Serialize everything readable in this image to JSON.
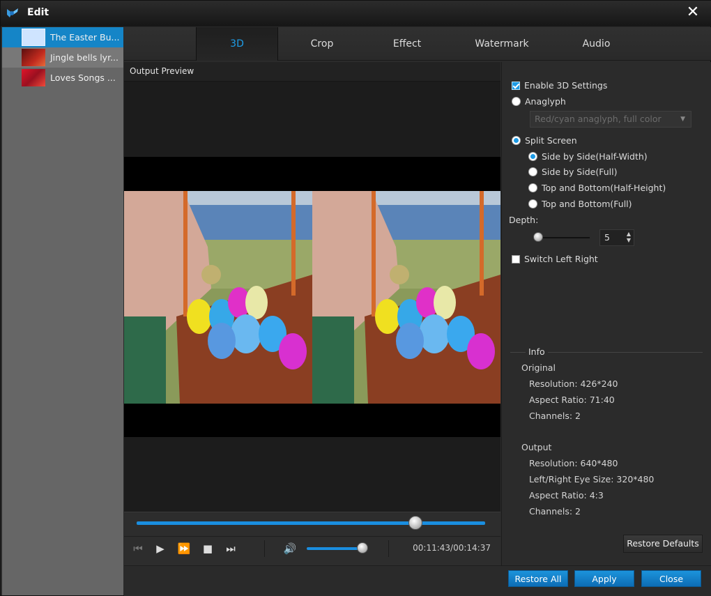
{
  "window": {
    "title": "Edit",
    "app_icon": "app-logo-icon",
    "close_icon": "close-icon"
  },
  "files": [
    {
      "label": "The Easter Bu...",
      "selected": true,
      "thumb_color": "#cfe4ff"
    },
    {
      "label": "Jingle bells lyr...",
      "selected": false,
      "thumb_color": "#a21a1a"
    },
    {
      "label": "Loves Songs ...",
      "selected": false,
      "thumb_color": "#c8202a"
    }
  ],
  "tabs": [
    {
      "label": "3D",
      "active": true
    },
    {
      "label": "Crop",
      "active": false
    },
    {
      "label": "Effect",
      "active": false
    },
    {
      "label": "Watermark",
      "active": false
    },
    {
      "label": "Audio",
      "active": false
    }
  ],
  "preview": {
    "header": "Output Preview",
    "seek_progress": 0.8,
    "volume": 1.0,
    "time": "00:11:43/00:14:37",
    "controls": [
      "skip-back-icon",
      "play-icon",
      "fast-forward-icon",
      "stop-icon",
      "skip-forward-icon",
      "volume-icon"
    ]
  },
  "settings": {
    "enable_3d": {
      "label": "Enable 3D Settings",
      "checked": true
    },
    "anaglyph": {
      "label": "Anaglyph",
      "selected": false
    },
    "anaglyph_mode": {
      "value": "Red/cyan anaglyph, full color",
      "disabled": true
    },
    "split_screen": {
      "label": "Split Screen",
      "selected": true
    },
    "split_options": [
      {
        "label": "Side by Side(Half-Width)",
        "selected": true
      },
      {
        "label": "Side by Side(Full)",
        "selected": false
      },
      {
        "label": "Top and Bottom(Half-Height)",
        "selected": false
      },
      {
        "label": "Top and Bottom(Full)",
        "selected": false
      }
    ],
    "depth": {
      "label": "Depth:",
      "value": "5",
      "slider_fraction": 0.05
    },
    "switch_lr": {
      "label": "Switch Left Right",
      "checked": false
    }
  },
  "info": {
    "title": "Info",
    "original": {
      "heading": "Original",
      "resolution": "Resolution: 426*240",
      "aspect": "Aspect Ratio: 71:40",
      "channels": "Channels: 2"
    },
    "output": {
      "heading": "Output",
      "resolution": "Resolution: 640*480",
      "eye_size": "Left/Right Eye Size: 320*480",
      "aspect": "Aspect Ratio: 4:3",
      "channels": "Channels: 2"
    }
  },
  "buttons": {
    "restore_defaults": "Restore Defaults",
    "restore_all": "Restore All",
    "apply": "Apply",
    "close": "Close"
  }
}
